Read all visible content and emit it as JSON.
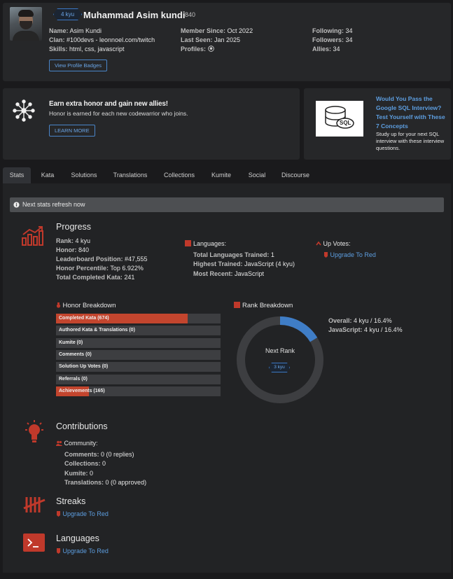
{
  "profile": {
    "rank": "4 kyu",
    "username": "Muhammad Asim kundi",
    "honor": "840",
    "name_label": "Name:",
    "name": "Asim Kundi",
    "clan_label": "Clan:",
    "clan": "#100devs - leonnoel.com/twitch",
    "skills_label": "Skills:",
    "skills": "html, css, javascript",
    "member_since_label": "Member Since:",
    "member_since": "Oct 2022",
    "last_seen_label": "Last Seen:",
    "last_seen": "Jan 2025",
    "profiles_label": "Profiles:",
    "following_label": "Following:",
    "following": "34",
    "followers_label": "Followers:",
    "followers": "34",
    "allies_label": "Allies:",
    "allies": "34",
    "view_badges": "View Profile Badges"
  },
  "banner": {
    "title": "Earn extra honor and gain new allies!",
    "text": "Honor is earned for each new codewarrior who joins.",
    "button": "LEARN MORE"
  },
  "ad": {
    "image_text": "SQL",
    "title": "Would You Pass the Google SQL Interview? Test Yourself with These 7 Concepts",
    "text": "Study up for your next SQL interview with these interview questions."
  },
  "tabs": [
    "Stats",
    "Kata",
    "Solutions",
    "Translations",
    "Collections",
    "Kumite",
    "Social",
    "Discourse"
  ],
  "stats": {
    "refresh": "Next stats refresh now",
    "progress": {
      "title": "Progress",
      "rank_label": "Rank:",
      "rank": "4 kyu",
      "honor_label": "Honor:",
      "honor": "840",
      "leaderboard_label": "Leaderboard Position:",
      "leaderboard": "#47,555",
      "percentile_label": "Honor Percentile:",
      "percentile": "Top 6.922%",
      "completed_label": "Total Completed Kata:",
      "completed": "241"
    },
    "languages": {
      "title": "Languages:",
      "trained_label": "Total Languages Trained:",
      "trained": "1",
      "highest_label": "Highest Trained:",
      "highest": "JavaScript (4 kyu)",
      "recent_label": "Most Recent:",
      "recent": "JavaScript"
    },
    "upvotes": {
      "title": "Up Votes:",
      "link": "Upgrade To Red"
    },
    "honor_breakdown": {
      "title": "Honor Breakdown",
      "bars": [
        {
          "label": "Completed Kata (674)",
          "fill": 0.8
        },
        {
          "label": "Authored Kata & Translations (0)",
          "fill": 0
        },
        {
          "label": "Kumite (0)",
          "fill": 0
        },
        {
          "label": "Comments (0)",
          "fill": 0
        },
        {
          "label": "Solution Up Votes (0)",
          "fill": 0
        },
        {
          "label": "Referrals (0)",
          "fill": 0
        },
        {
          "label": "Achievements (165)",
          "fill": 0.2
        }
      ]
    },
    "rank_breakdown": {
      "title": "Rank Breakdown",
      "center_text": "Next Rank",
      "center_badge": "3 kyu",
      "progress": 0.164,
      "overall_label": "Overall:",
      "overall": "4 kyu / 16.4%",
      "js_label": "JavaScript:",
      "js": "4 kyu / 16.4%"
    },
    "contributions": {
      "title": "Contributions",
      "community": "Community:",
      "comments_label": "Comments:",
      "comments": "0 (0 replies)",
      "collections_label": "Collections:",
      "collections": "0",
      "kumite_label": "Kumite:",
      "kumite": "0",
      "translations_label": "Translations:",
      "translations": "0 (0 approved)"
    },
    "streaks": {
      "title": "Streaks",
      "link": "Upgrade To Red"
    },
    "languages_section": {
      "title": "Languages",
      "link": "Upgrade To Red"
    }
  },
  "colors": {
    "accent_red": "#c0392b",
    "link_blue": "#5d9ee0",
    "rank_blue": "#3b78c4"
  }
}
